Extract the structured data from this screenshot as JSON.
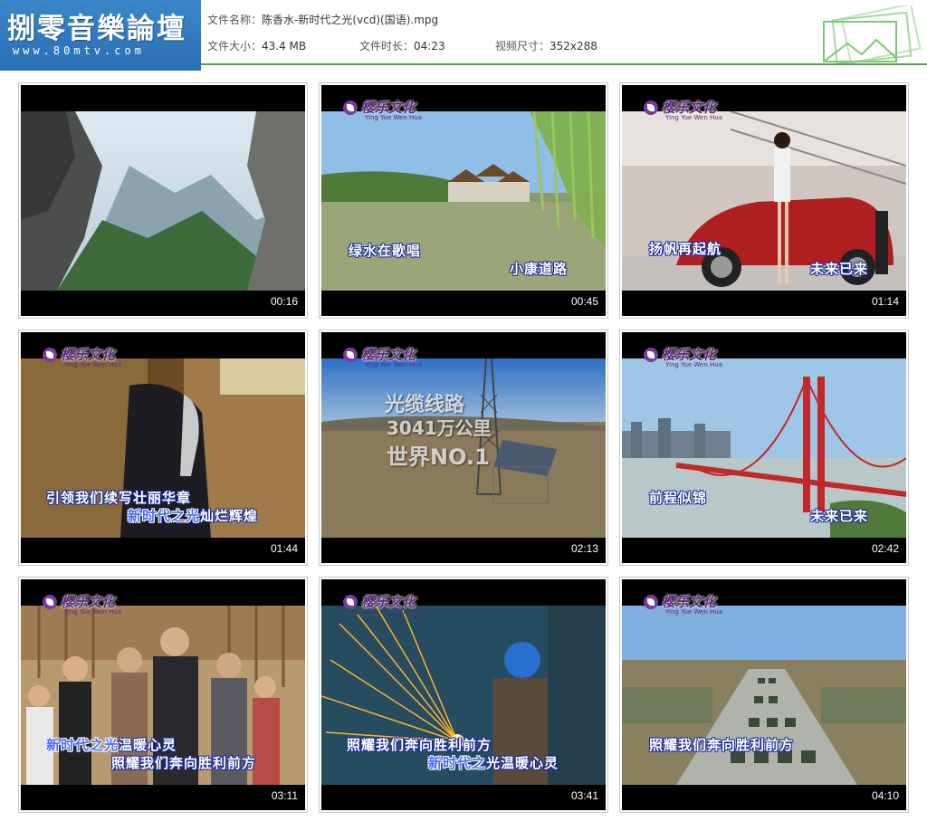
{
  "logo": {
    "title": "捌零音樂論壇",
    "url": "www.80mtv.com"
  },
  "file_info": {
    "name_label": "文件名称：",
    "name_value": "陈香水-新时代之光(vcd)(国语).mpg",
    "size_label": "文件大小：",
    "size_value": "43.4 MB",
    "duration_label": "文件时长：",
    "duration_value": "04:23",
    "dimensions_label": "视频尺寸：",
    "dimensions_value": "352x288"
  },
  "brand": {
    "name": "樱乐文化",
    "sub": "Ying Yue Wen Hua"
  },
  "colors": {
    "logo_bg": "#2a6fb3",
    "accent_line": "#4ea84a",
    "subtitle_outline": "#1a2a9a",
    "subtitle_highlight": "#4a6cff"
  },
  "thumbnails": [
    {
      "time": "00:16",
      "subtitle_1": "",
      "subtitle_2": ""
    },
    {
      "time": "00:45",
      "subtitle_1": "绿水在歌唱",
      "subtitle_2": "小康道路"
    },
    {
      "time": "01:14",
      "subtitle_1": "扬帆再起航",
      "subtitle_2": "未来已来"
    },
    {
      "time": "01:44",
      "subtitle_1": "引领我们续写壮丽华章",
      "subtitle_2_hl": "新时代之光",
      "subtitle_2": "灿烂辉煌"
    },
    {
      "time": "02:13",
      "subtitle_1": "",
      "subtitle_2": "",
      "overlay_1": "光缆线路",
      "overlay_2": "3041万公里",
      "overlay_3": "世界NO.1"
    },
    {
      "time": "02:42",
      "subtitle_1": "前程似锦",
      "subtitle_2": "未来已来"
    },
    {
      "time": "03:11",
      "subtitle_1_hl": "新时代之光",
      "subtitle_1": "温暖心灵",
      "subtitle_2": "照耀我们奔向胜利前方"
    },
    {
      "time": "03:41",
      "subtitle_1": "照耀我们奔向胜利前方",
      "subtitle_2_hl": "新时代之",
      "subtitle_2": "光温暖心灵"
    },
    {
      "time": "04:10",
      "subtitle_1": "照耀我们奔向胜利前方",
      "subtitle_2": ""
    }
  ]
}
